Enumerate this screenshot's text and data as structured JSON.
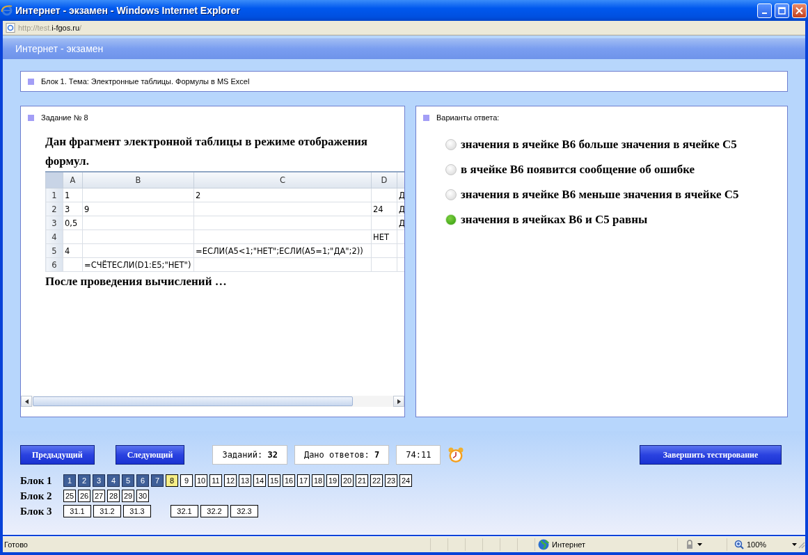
{
  "window": {
    "title": "Интернет - экзамен - Windows Internet Explorer"
  },
  "address": {
    "prefix": "http://test.",
    "host": "i-fgos.ru",
    "suffix": "/"
  },
  "page_header": "Интернет - экзамен",
  "topic": "Блок 1. Тема: Электронные таблицы. Формулы в MS Excel",
  "task": {
    "heading": "Задание № 8",
    "intro": "Дан фрагмент электронной таблицы в режиме отображения формул.",
    "outro": "После проведения вычислений  …",
    "sheet": {
      "columns": [
        "A",
        "B",
        "C",
        "D"
      ],
      "rows": [
        {
          "number": "1",
          "cells": [
            "1",
            "",
            "2",
            "",
            "Д"
          ]
        },
        {
          "number": "2",
          "cells": [
            "3",
            "9",
            "",
            "24",
            "Д"
          ]
        },
        {
          "number": "3",
          "cells": [
            "0,5",
            "",
            "",
            "",
            "Д"
          ]
        },
        {
          "number": "4",
          "cells": [
            "",
            "",
            "",
            "НЕТ",
            ""
          ]
        },
        {
          "number": "5",
          "cells": [
            "4",
            "",
            "=ЕСЛИ(A5<1;\"НЕТ\";ЕСЛИ(A5=1;\"ДА\";2))",
            "",
            ""
          ]
        },
        {
          "number": "6",
          "cells": [
            "",
            "=СЧЁТЕСЛИ(D1:E5;\"НЕТ\")",
            "",
            "",
            ""
          ]
        }
      ]
    }
  },
  "answers": {
    "heading": "Варианты ответа:",
    "options": [
      {
        "label": "значения в ячейке B6 больше значения в ячейке C5",
        "selected": false
      },
      {
        "label": "в ячейке B6 появится сообщение об ошибке",
        "selected": false
      },
      {
        "label": "значения в ячейке B6 меньше значения в ячейке C5",
        "selected": false
      },
      {
        "label": "значения в ячейках B6 и C5 равны",
        "selected": true
      }
    ]
  },
  "controls": {
    "prev": "Предыдущий",
    "next": "Следующий",
    "total": "Заданий: **32**",
    "answered": "Дано ответов: **7**",
    "timer": "74:11",
    "finish": "Завершить тестирование"
  },
  "blocks": [
    {
      "label": "Блок 1",
      "groups": [
        [
          {
            "n": "1",
            "answered": true,
            "selected": false
          },
          {
            "n": "2",
            "answered": true,
            "selected": false
          },
          {
            "n": "3",
            "answered": true,
            "selected": false
          },
          {
            "n": "4",
            "answered": true,
            "selected": false
          },
          {
            "n": "5",
            "answered": true,
            "selected": false
          },
          {
            "n": "6",
            "answered": true,
            "selected": false
          },
          {
            "n": "7",
            "answered": true,
            "selected": false
          },
          {
            "n": "8",
            "answered": false,
            "selected": true
          },
          {
            "n": "9",
            "answered": false,
            "selected": false
          },
          {
            "n": "10",
            "answered": false,
            "selected": false
          },
          {
            "n": "11",
            "answered": false,
            "selected": false
          },
          {
            "n": "12",
            "answered": false,
            "selected": false
          },
          {
            "n": "13",
            "answered": false,
            "selected": false
          },
          {
            "n": "14",
            "answered": false,
            "selected": false
          },
          {
            "n": "15",
            "answered": false,
            "selected": false
          },
          {
            "n": "16",
            "answered": false,
            "selected": false
          },
          {
            "n": "17",
            "answered": false,
            "selected": false
          },
          {
            "n": "18",
            "answered": false,
            "selected": false
          },
          {
            "n": "19",
            "answered": false,
            "selected": false
          },
          {
            "n": "20",
            "answered": false,
            "selected": false
          },
          {
            "n": "21",
            "answered": false,
            "selected": false
          },
          {
            "n": "22",
            "answered": false,
            "selected": false
          },
          {
            "n": "23",
            "answered": false,
            "selected": false
          },
          {
            "n": "24",
            "answered": false,
            "selected": false
          }
        ]
      ]
    },
    {
      "label": "Блок 2",
      "groups": [
        [
          {
            "n": "25",
            "answered": false,
            "selected": false
          },
          {
            "n": "26",
            "answered": false,
            "selected": false
          },
          {
            "n": "27",
            "answered": false,
            "selected": false
          },
          {
            "n": "28",
            "answered": false,
            "selected": false
          },
          {
            "n": "29",
            "answered": false,
            "selected": false
          },
          {
            "n": "30",
            "answered": false,
            "selected": false
          }
        ]
      ]
    },
    {
      "label": "Блок 3",
      "groups": [
        [
          {
            "n": "31.1",
            "answered": false,
            "selected": false
          },
          {
            "n": "31.2",
            "answered": false,
            "selected": false
          },
          {
            "n": "31.3",
            "answered": false,
            "selected": false
          }
        ],
        [
          {
            "n": "32.1",
            "answered": false,
            "selected": false
          },
          {
            "n": "32.2",
            "answered": false,
            "selected": false
          },
          {
            "n": "32.3",
            "answered": false,
            "selected": false
          }
        ]
      ]
    }
  ],
  "status_bar": {
    "text": "Готово",
    "zone": "Интернет",
    "zoom": "100%"
  }
}
